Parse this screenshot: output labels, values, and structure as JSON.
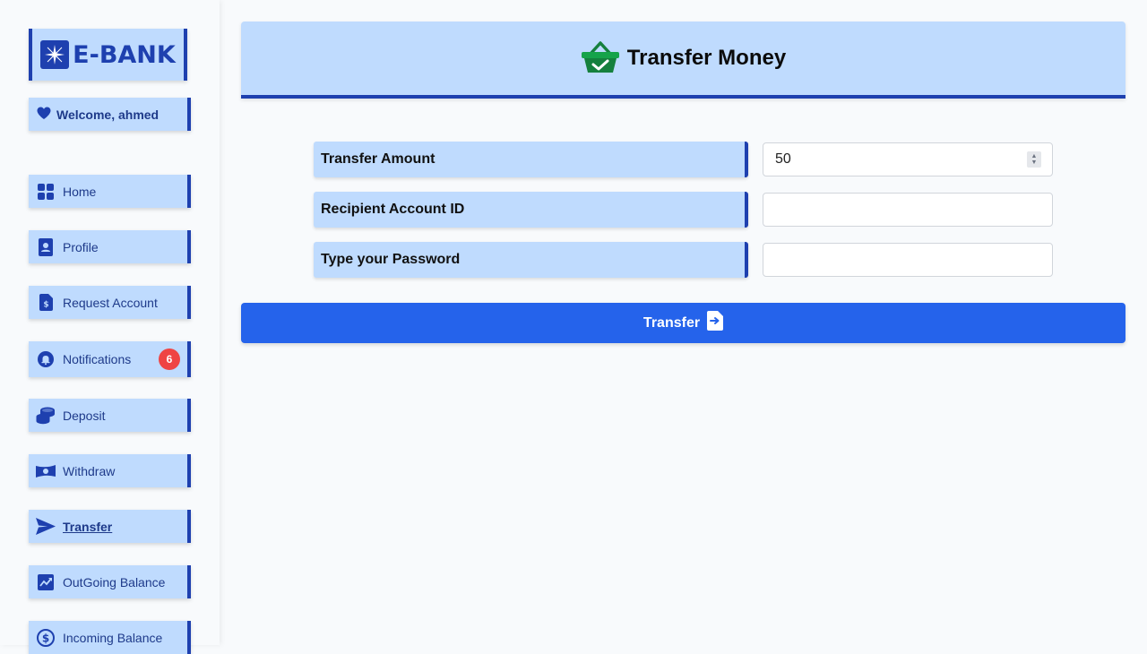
{
  "brand": {
    "name": "E-BANK",
    "icon": "sparkle-logo-icon"
  },
  "user": {
    "welcome": "Welcome, ahmed"
  },
  "sidebar": {
    "items": [
      {
        "label": "Home",
        "icon": "grid-icon"
      },
      {
        "label": "Profile",
        "icon": "id-card-icon"
      },
      {
        "label": "Request Account",
        "icon": "dollar-file-icon"
      },
      {
        "label": "Notifications",
        "icon": "bell-icon",
        "badge": "6"
      },
      {
        "label": "Deposit",
        "icon": "coins-icon"
      },
      {
        "label": "Withdraw",
        "icon": "money-bill-icon"
      },
      {
        "label": "Transfer",
        "icon": "paper-plane-icon",
        "active": true
      },
      {
        "label": "OutGoing Balance",
        "icon": "chart-line-icon"
      },
      {
        "label": "Incoming Balance",
        "icon": "circle-dollar-icon"
      }
    ]
  },
  "page": {
    "title": "Transfer Money",
    "title_icon": "basket-check-icon"
  },
  "form": {
    "amount_label": "Transfer Amount",
    "amount_value": "50",
    "recipient_label": "Recipient Account ID",
    "recipient_value": "",
    "password_label": "Type your Password",
    "password_value": "",
    "submit_label": "Transfer",
    "submit_icon": "file-arrow-right-icon"
  },
  "colors": {
    "accent": "#1e40af",
    "panel": "#bfdbfe",
    "button": "#2563eb",
    "badge": "#ef4444",
    "basket": "#16a34a"
  }
}
